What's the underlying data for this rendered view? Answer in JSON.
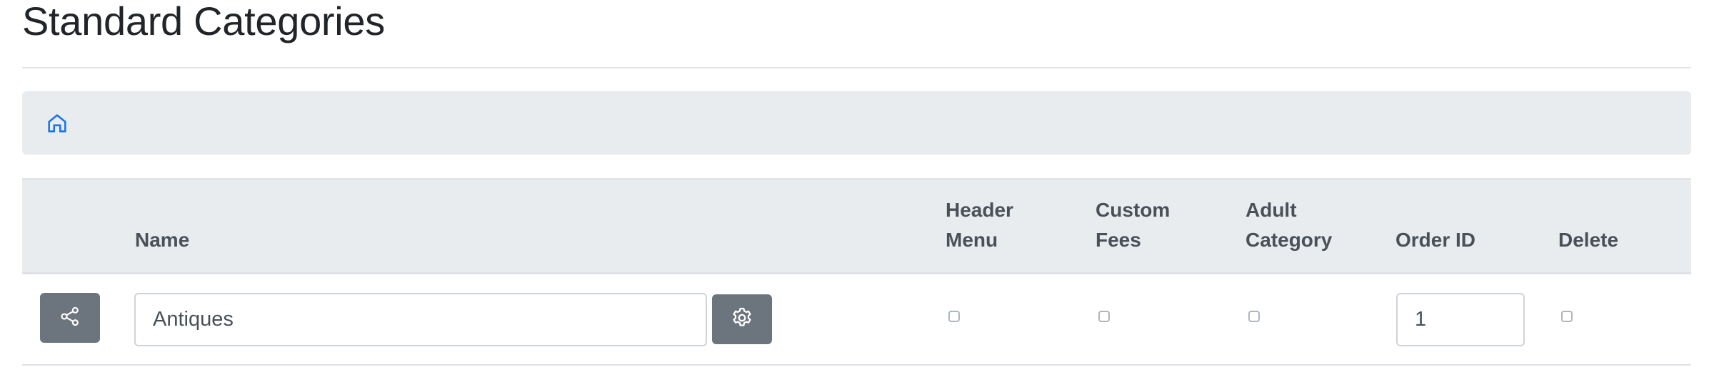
{
  "page": {
    "title": "Standard Categories"
  },
  "breadcrumb": {
    "home_icon": "home-icon",
    "accent_color": "#1a73e8"
  },
  "table": {
    "headers": {
      "name": "Name",
      "header_menu_line1": "Header",
      "header_menu_line2": "Menu",
      "custom_fees_line1": "Custom",
      "custom_fees_line2": "Fees",
      "adult_category_line1": "Adult",
      "adult_category_line2": "Category",
      "order_id": "Order ID",
      "delete": "Delete"
    },
    "rows": [
      {
        "share_icon": "share-icon",
        "name_value": "Antiques",
        "settings_icon": "gear-icon",
        "header_menu_checked": false,
        "custom_fees_checked": false,
        "adult_category_checked": false,
        "order_id_value": "1",
        "delete_checked": false
      }
    ]
  },
  "colors": {
    "button_bg": "#6c757d",
    "header_bg": "#e9ecef",
    "breadcrumb_bg": "#e9ecef"
  }
}
